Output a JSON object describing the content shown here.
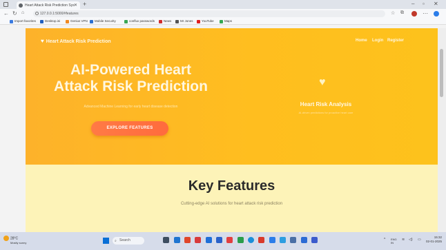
{
  "browser": {
    "tab_title": "Heart Attack Risk Prediction Sys",
    "url": "127.0.0.1:5000/#features",
    "bookmarks": [
      "Import favorites",
      "Desktop.ini",
      "Genius VPN",
      "Mobile Security",
      "conflux passwords",
      "News",
      "Mr Jones",
      "YouTube",
      "Maps"
    ]
  },
  "site": {
    "brand": "Heart Attack Risk Prediction",
    "nav": {
      "home": "Home",
      "login": "Login",
      "register": "Register"
    },
    "hero": {
      "title_line1": "AI-Powered Heart",
      "title_line2": "Attack Risk Prediction",
      "subtitle": "Advanced Machine Learning for early heart disease detection",
      "cta": "EXPLORE FEATURES"
    },
    "card": {
      "title": "Heart Risk Analysis",
      "subtitle": "AI-driven predictions for proactive heart care"
    },
    "features": {
      "title": "Key Features",
      "subtitle": "Cutting-edge AI solutions for heart attack risk prediction"
    }
  },
  "taskbar": {
    "weather_temp": "28°C",
    "weather_desc": "Mostly sunny",
    "search_placeholder": "Search",
    "lang": "ENG",
    "lang2": "IN",
    "time": "15:32",
    "date": "02-01-2025"
  },
  "colors": {
    "hero_gradient_start": "#fdb22a",
    "hero_gradient_end": "#fdc21c",
    "cta": "#ff6b3d",
    "features_bg": "#fdf3b8"
  }
}
